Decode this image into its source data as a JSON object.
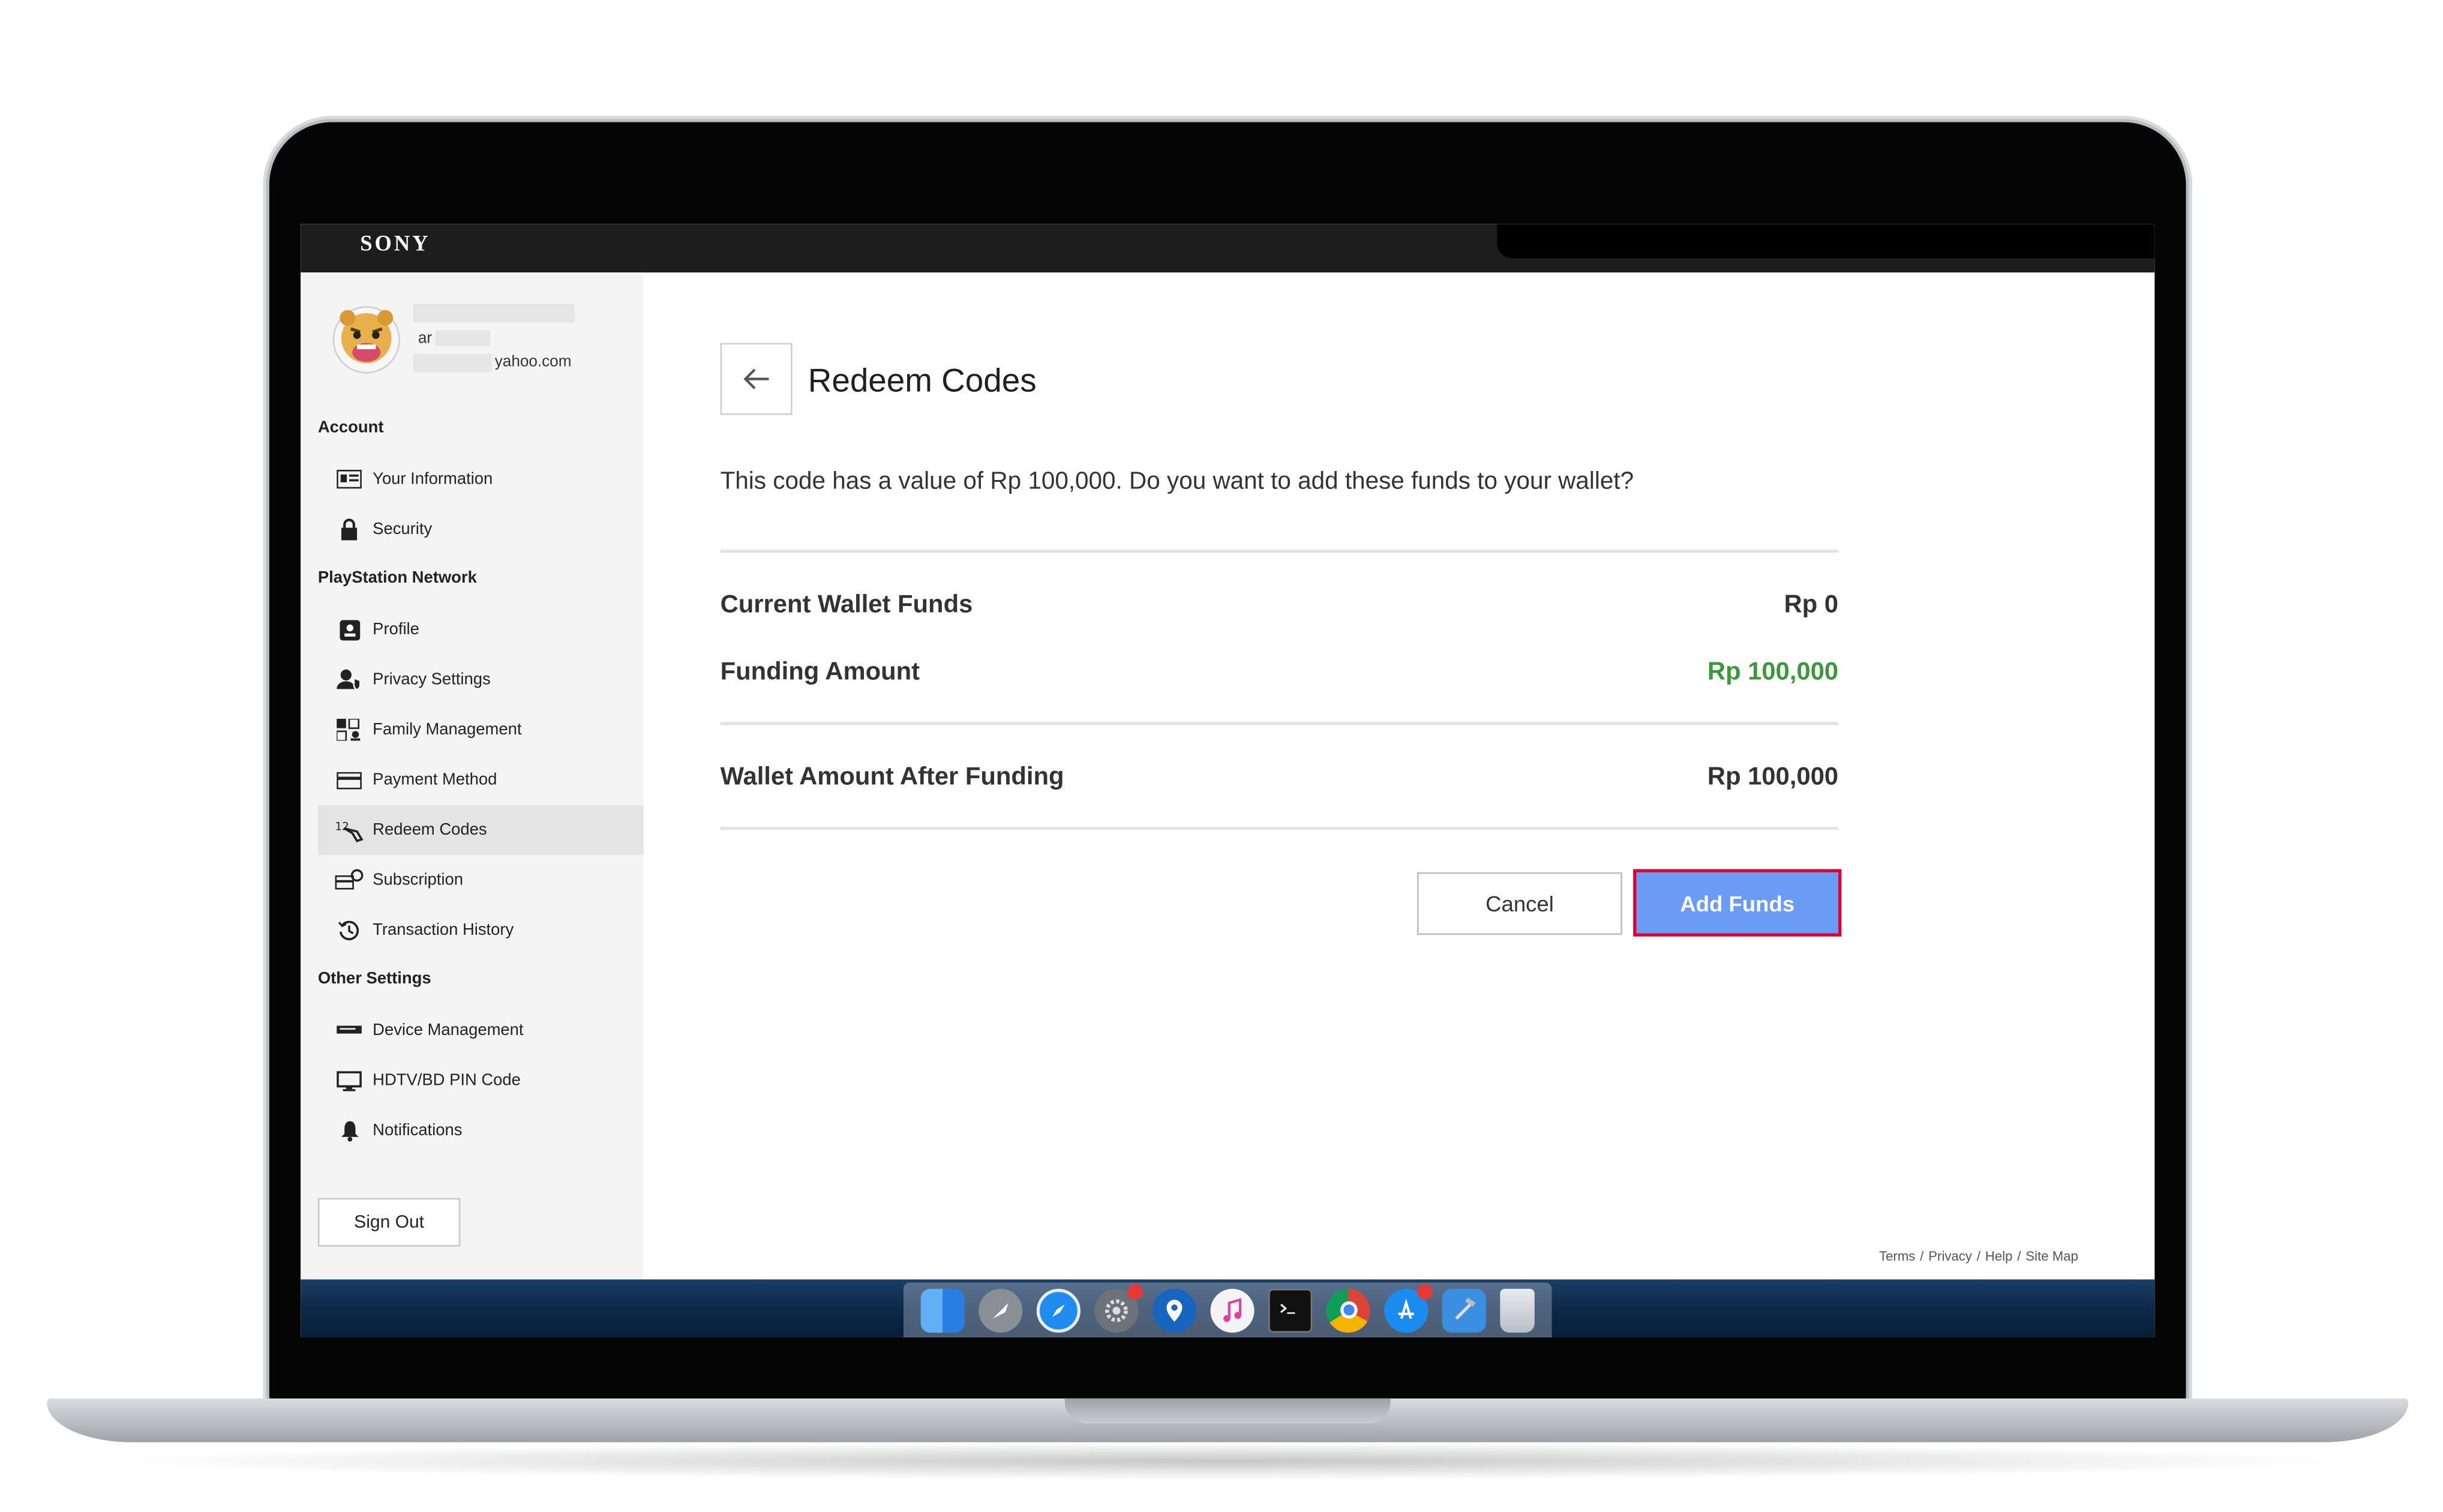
{
  "brand": {
    "logo": "SONY"
  },
  "user": {
    "name_prefix": "ar",
    "email_suffix": "yahoo.com"
  },
  "sidebar": {
    "sections": [
      {
        "title": "Account",
        "items": [
          {
            "label": "Your Information",
            "icon": "id-card-icon"
          },
          {
            "label": "Security",
            "icon": "lock-icon"
          }
        ]
      },
      {
        "title": "PlayStation Network",
        "items": [
          {
            "label": "Profile",
            "icon": "profile-icon"
          },
          {
            "label": "Privacy Settings",
            "icon": "privacy-icon"
          },
          {
            "label": "Family Management",
            "icon": "family-icon"
          },
          {
            "label": "Payment Method",
            "icon": "credit-card-icon"
          },
          {
            "label": "Redeem Codes",
            "icon": "redeem-icon",
            "active": true
          },
          {
            "label": "Subscription",
            "icon": "subscription-icon"
          },
          {
            "label": "Transaction History",
            "icon": "history-icon"
          }
        ]
      },
      {
        "title": "Other Settings",
        "items": [
          {
            "label": "Device Management",
            "icon": "device-icon"
          },
          {
            "label": "HDTV/BD PIN Code",
            "icon": "monitor-icon"
          },
          {
            "label": "Notifications",
            "icon": "bell-icon"
          }
        ]
      }
    ],
    "sign_out": "Sign Out"
  },
  "main": {
    "title": "Redeem Codes",
    "question": "This code has a value of Rp 100,000. Do you want to add these funds to your wallet?",
    "rows": [
      {
        "label": "Current Wallet Funds",
        "value": "Rp 0"
      },
      {
        "label": "Funding Amount",
        "value": "Rp 100,000"
      },
      {
        "label": "Wallet Amount After Funding",
        "value": "Rp 100,000"
      }
    ],
    "cancel_label": "Cancel",
    "add_funds_label": "Add Funds"
  },
  "footer": {
    "links": [
      "Terms",
      "Privacy",
      "Help",
      "Site Map"
    ],
    "separator": "/"
  },
  "dock": {
    "apps": [
      "finder-icon",
      "launchpad-icon",
      "safari-icon",
      "system-preferences-icon",
      "maps-pin-icon",
      "music-icon",
      "terminal-icon",
      "chrome-icon",
      "app-store-icon",
      "xcode-icon",
      "trash-icon"
    ]
  },
  "colors": {
    "accent_button": "#6a9cf5",
    "highlight_border": "#e4002b",
    "positive_value": "#3a9a3a"
  }
}
